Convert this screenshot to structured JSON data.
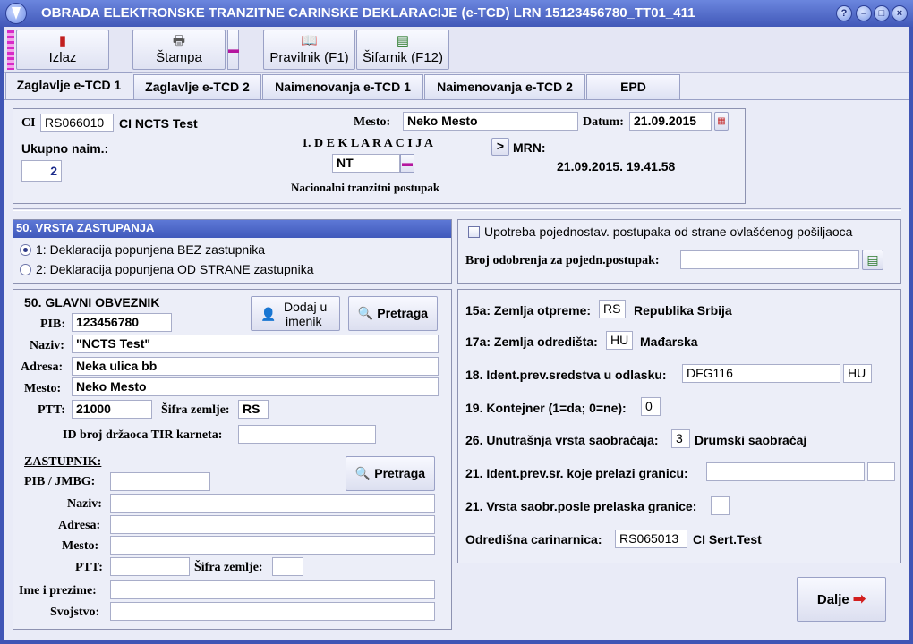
{
  "window": {
    "title": "OBRADA ELEKTRONSKE TRANZITNE CARINSKE DEKLARACIJE (e-TCD)  LRN 15123456780_TT01_411"
  },
  "toolbar": {
    "izlaz": "Izlaz",
    "stampa": "Štampa",
    "pravilnik": "Pravilnik (F1)",
    "sifarnik": "Šifarnik (F12)"
  },
  "tabs": [
    "Zaglavlje e-TCD 1",
    "Zaglavlje e-TCD 2",
    "Naimenovanja e-TCD 1",
    "Naimenovanja e-TCD 2",
    "EPD"
  ],
  "header": {
    "ci_label": "CI",
    "ci_code": "RS066010",
    "ci_name": "CI NCTS Test",
    "ukupno_label": "Ukupno naim.:",
    "ukupno_value": "2",
    "deklaracija_label": "1.  D E K L A R A C I J A",
    "deklaracija_value": "NT",
    "postupak": "Nacionalni tranzitni postupak",
    "mesto_label": "Mesto:",
    "mesto_value": "Neko Mesto",
    "datum_label": "Datum:",
    "datum_value": "21.09.2015",
    "mrn_btn": ">",
    "mrn_label": "MRN:",
    "mrn_datetime": "21.09.2015. 19.41.58"
  },
  "zastupanje": {
    "title": "50. VRSTA ZASTUPANJA",
    "option1": "1: Deklaracija popunjena BEZ zastupnika",
    "option2": "2: Deklaracija popunjena OD STRANE zastupnika",
    "selected": 1
  },
  "ovlasceni": {
    "checkbox_label": "Upotreba pojednostav. postupaka od strane ovlašćenog pošiljaoca",
    "odobrenje_label": "Broj odobrenja za pojedn.postupak:",
    "odobrenje_value": ""
  },
  "obveznik": {
    "title": "50. GLAVNI OBVEZNIK",
    "dodaj_btn_line1": "Dodaj u",
    "dodaj_btn_line2": "imenik",
    "pretraga_btn": "Pretraga",
    "pib_label": "PIB:",
    "pib_value": "123456780",
    "naziv_label": "Naziv:",
    "naziv_value": "\"NCTS Test\"",
    "adresa_label": "Adresa:",
    "adresa_value": "Neka ulica bb",
    "mesto_label": "Mesto:",
    "mesto_value": "Neko Mesto",
    "ptt_label": "PTT:",
    "ptt_value": "21000",
    "sifra_label": "Šifra zemlje:",
    "sifra_value": "RS",
    "tir_label": "ID broj držaoca TIR karneta:",
    "tir_value": ""
  },
  "zastupnik": {
    "title": "ZASTUPNIK:",
    "pretraga_btn": "Pretraga",
    "pib_label": "PIB / JMBG:",
    "naziv_label": "Naziv:",
    "adresa_label": "Adresa:",
    "mesto_label": "Mesto:",
    "ptt_label": "PTT:",
    "sifra_label": "Šifra zemlje:",
    "ime_label": "Ime i prezime:",
    "svojstvo_label": "Svojstvo:"
  },
  "transport": {
    "zemlja_otpreme_label": "15a: Zemlja otpreme:",
    "zemlja_otpreme_code": "RS",
    "zemlja_otpreme_name": "Republika Srbija",
    "zemlja_odredista_label": "17a: Zemlja odredišta:",
    "zemlja_odredista_code": "HU",
    "zemlja_odredista_name": "Mađarska",
    "ident_odlazak_label": "18. Ident.prev.sredstva u odlasku:",
    "ident_odlazak_value": "DFG116",
    "ident_odlazak_country": "HU",
    "kontejner_label": "19. Kontejner (1=da; 0=ne):",
    "kontejner_value": "0",
    "unutrasnja_label": "26. Unutrašnja vrsta saobraćaja:",
    "unutrasnja_value": "3",
    "unutrasnja_name": "Drumski saobraćaj",
    "granica_label": "21. Ident.prev.sr. koje prelazi granicu:",
    "vrsta_posle_label": "21. Vrsta saobr.posle prelaska granice:",
    "odredisna_label": "Odredišna carinarnica:",
    "odredisna_code": "RS065013",
    "odredisna_name": "CI Sert.Test"
  },
  "footer": {
    "dalje": "Dalje"
  }
}
